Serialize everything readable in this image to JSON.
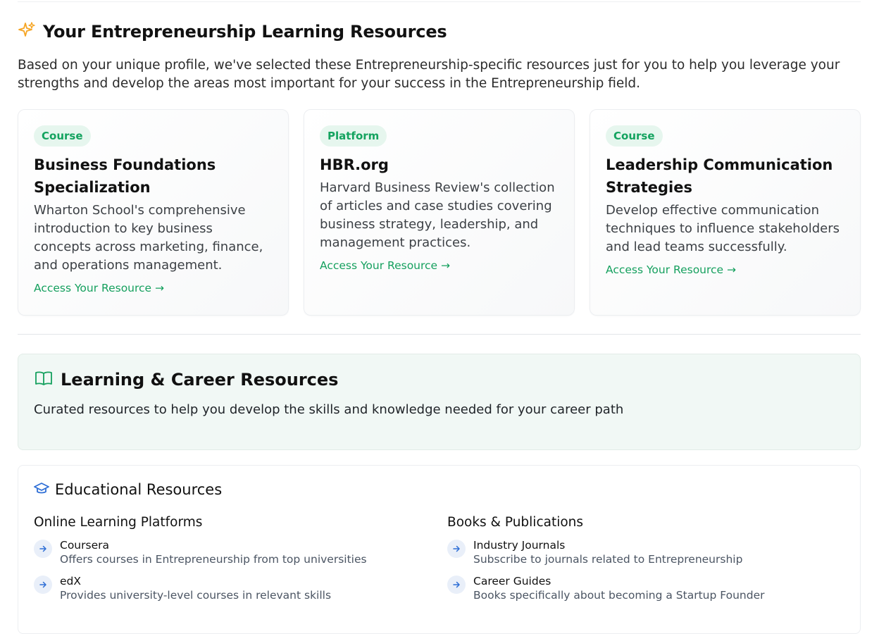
{
  "personalized": {
    "title": "Your Entrepreneurship Learning Resources",
    "intro": "Based on your unique profile, we've selected these Entrepreneurship-specific resources just for you to help you leverage your strengths and develop the areas most important for your success in the Entrepreneurship field.",
    "cards": [
      {
        "badge": "Course",
        "title": "Business Foundations Specialization",
        "description": "Wharton School's comprehensive introduction to key business concepts across marketing, finance, and operations management.",
        "link": "Access Your Resource →"
      },
      {
        "badge": "Platform",
        "title": "HBR.org",
        "description": "Harvard Business Review's collection of articles and case studies covering business strategy, leadership, and management practices.",
        "link": "Access Your Resource →"
      },
      {
        "badge": "Course",
        "title": "Leadership Communication Strategies",
        "description": "Develop effective communication techniques to influence stakeholders and lead teams successfully.",
        "link": "Access Your Resource →"
      }
    ]
  },
  "learning_career": {
    "title": "Learning & Career Resources",
    "subtitle": "Curated resources to help you develop the skills and knowledge needed for your career path"
  },
  "educational": {
    "title": "Educational Resources",
    "columns": [
      {
        "title": "Online Learning Platforms",
        "items": [
          {
            "name": "Coursera",
            "description": "Offers courses in Entrepreneurship from top universities"
          },
          {
            "name": "edX",
            "description": "Provides university-level courses in relevant skills"
          }
        ]
      },
      {
        "title": "Books & Publications",
        "items": [
          {
            "name": "Industry Journals",
            "description": "Subscribe to journals related to Entrepreneurship"
          },
          {
            "name": "Career Guides",
            "description": "Books specifically about becoming a Startup Founder"
          }
        ]
      }
    ]
  },
  "colors": {
    "accent_green": "#15a05e",
    "badge_bg": "#e6f6ee",
    "sparkle_orange": "#f5a524",
    "graduation_blue": "#2f6fd6"
  }
}
